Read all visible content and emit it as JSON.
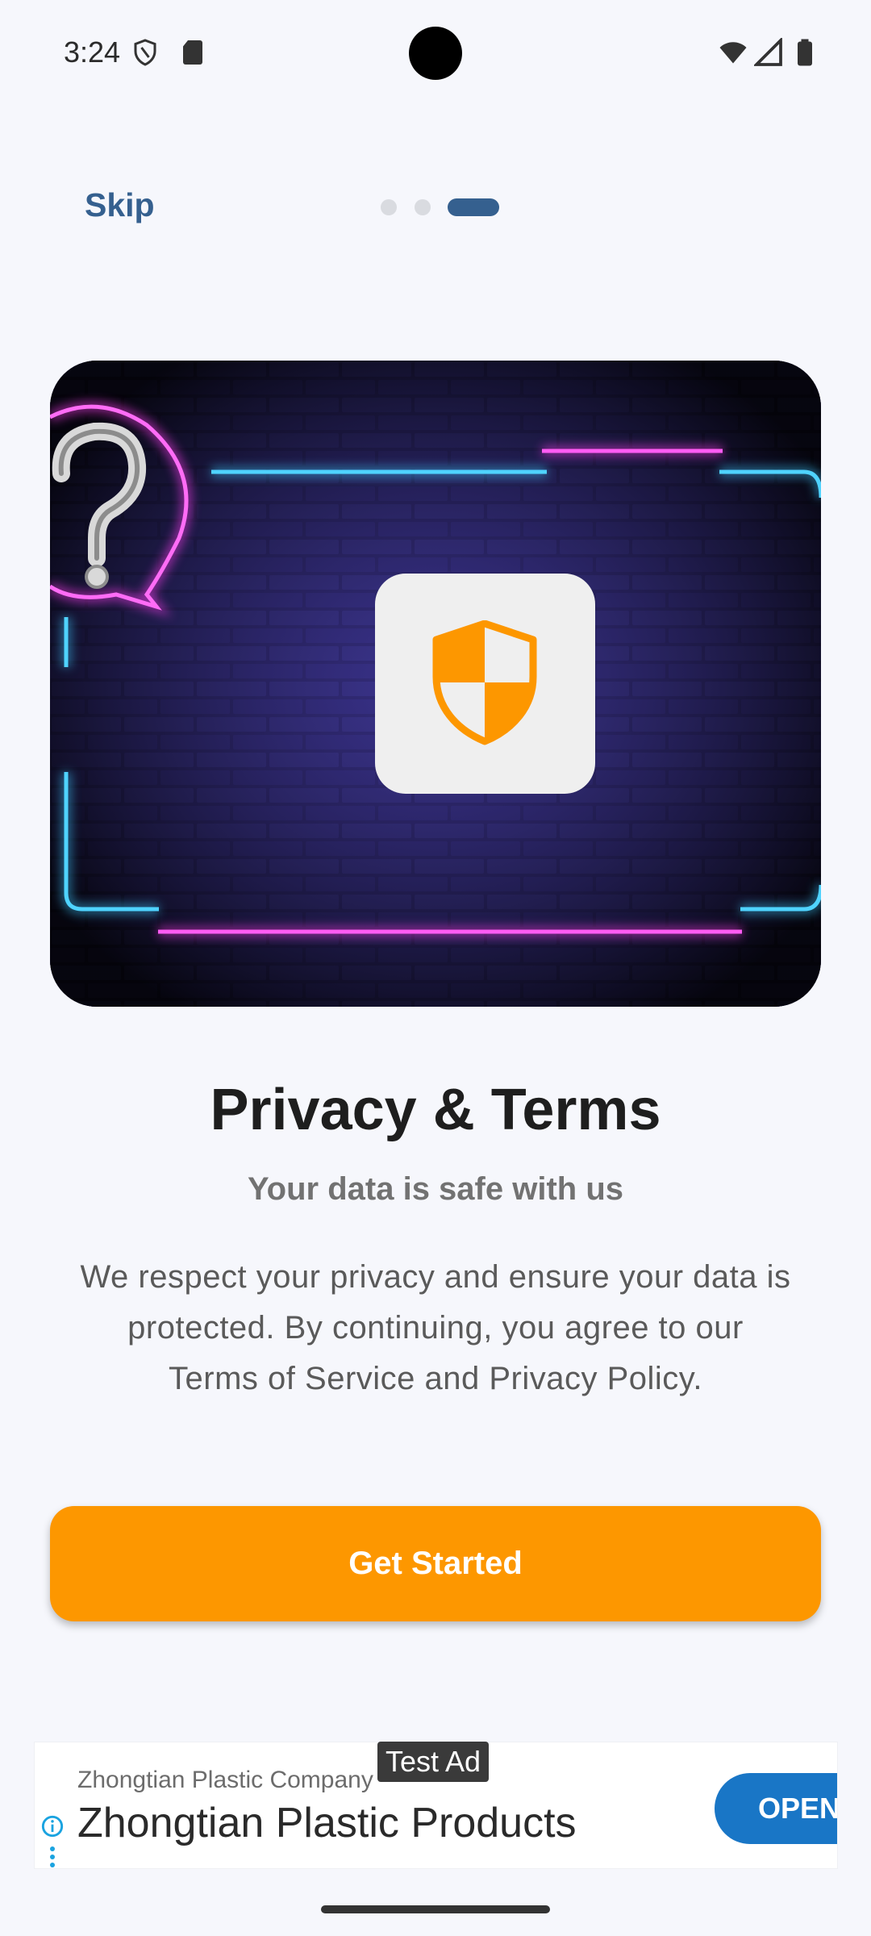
{
  "status_bar": {
    "time": "3:24",
    "icons": [
      "shield-icon",
      "sd-card-icon",
      "wifi-icon",
      "signal-icon",
      "battery-icon"
    ]
  },
  "nav": {
    "skip_label": "Skip",
    "page_indicator": {
      "total": 3,
      "current": 3
    }
  },
  "hero": {
    "icon": "shield-icon",
    "colors": {
      "accent": "#fd9700",
      "neon_pink": "#ff3cf0",
      "neon_blue": "#3cc8ff"
    }
  },
  "content": {
    "title": "Privacy & Terms",
    "subtitle": "Your data is safe with us",
    "body_line1": "We respect your privacy and ensure your data is",
    "body_line2": "protected. By continuing, you agree to our",
    "body_line3": "Terms of Service and Privacy Policy."
  },
  "cta": {
    "label": "Get Started",
    "color": "#fd9700"
  },
  "ad": {
    "badge": "Test Ad",
    "company": "Zhongtian Plastic Company",
    "headline": "Zhongtian Plastic Products",
    "open_label": "OPEN"
  }
}
